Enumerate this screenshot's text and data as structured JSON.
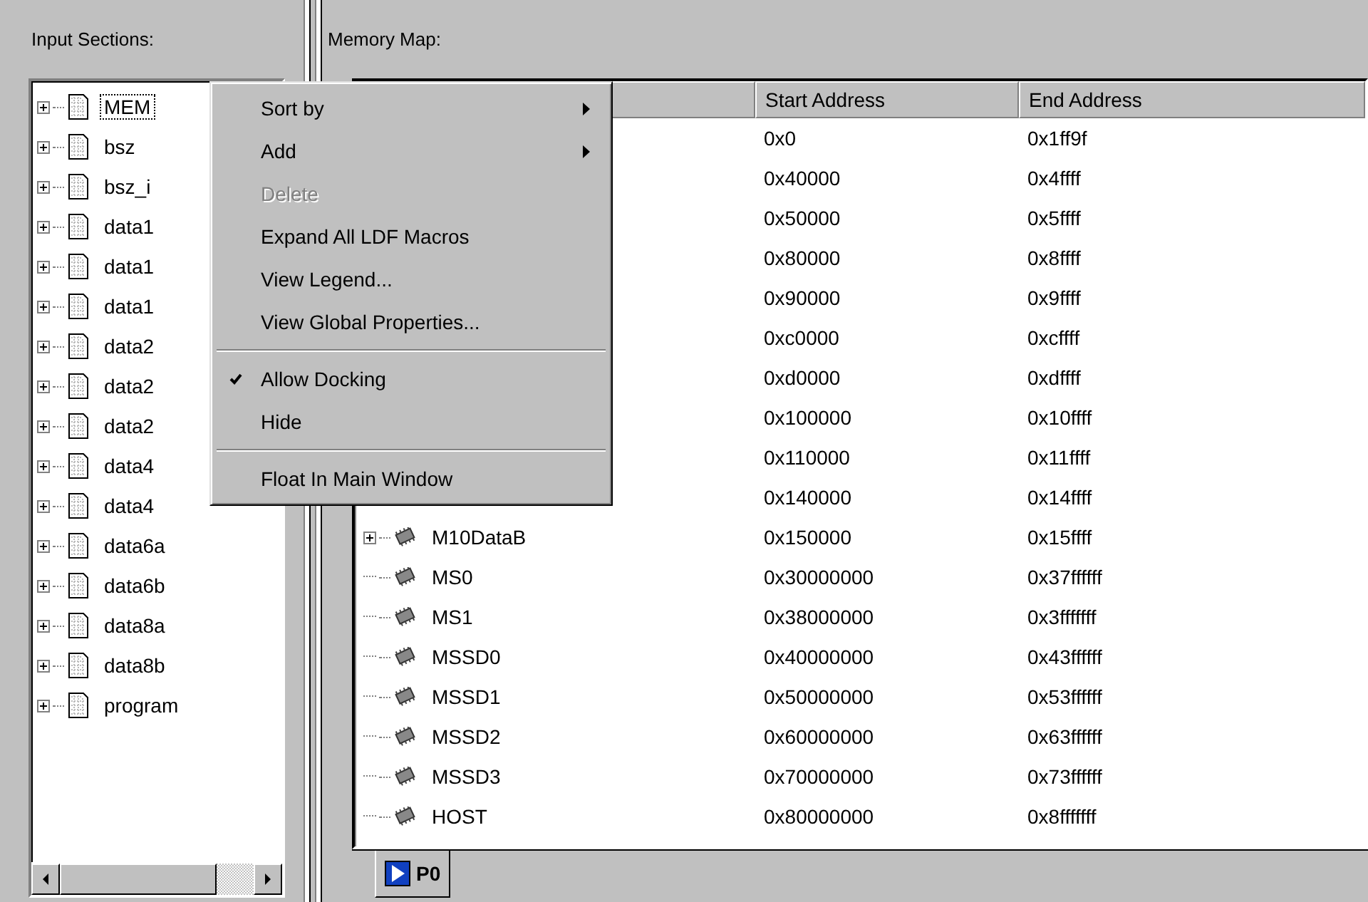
{
  "input_sections": {
    "label": "Input Sections:",
    "items": [
      {
        "name": "MEM",
        "expandable": true,
        "focused": true
      },
      {
        "name": "bsz",
        "expandable": true,
        "focused": false
      },
      {
        "name": "bsz_i",
        "expandable": true,
        "focused": false
      },
      {
        "name": "data1",
        "expandable": true,
        "focused": false
      },
      {
        "name": "data1",
        "expandable": true,
        "focused": false
      },
      {
        "name": "data1",
        "expandable": true,
        "focused": false
      },
      {
        "name": "data2",
        "expandable": true,
        "focused": false
      },
      {
        "name": "data2",
        "expandable": true,
        "focused": false
      },
      {
        "name": "data2",
        "expandable": true,
        "focused": false
      },
      {
        "name": "data4",
        "expandable": true,
        "focused": false
      },
      {
        "name": "data4",
        "expandable": true,
        "focused": false
      },
      {
        "name": "data6a",
        "expandable": true,
        "focused": false
      },
      {
        "name": "data6b",
        "expandable": true,
        "focused": false
      },
      {
        "name": "data8a",
        "expandable": true,
        "focused": false
      },
      {
        "name": "data8b",
        "expandable": true,
        "focused": false
      },
      {
        "name": "program",
        "expandable": true,
        "focused": false
      }
    ]
  },
  "memory_map": {
    "label": "Memory Map:",
    "columns": [
      "Start Address",
      "End Address"
    ],
    "rows": [
      {
        "start": "0x0",
        "end": "0x1ff9f"
      },
      {
        "start": "0x40000",
        "end": "0x4ffff"
      },
      {
        "start": "0x50000",
        "end": "0x5ffff"
      },
      {
        "start": "0x80000",
        "end": "0x8ffff"
      },
      {
        "start": "0x90000",
        "end": "0x9ffff"
      },
      {
        "start": "0xc0000",
        "end": "0xcffff"
      },
      {
        "start": "0xd0000",
        "end": "0xdffff"
      },
      {
        "start": "0x100000",
        "end": "0x10ffff"
      },
      {
        "start": "0x110000",
        "end": "0x11ffff"
      },
      {
        "start": "0x140000",
        "end": "0x14ffff"
      },
      {
        "name": "M10DataB",
        "expandable": true,
        "start": "0x150000",
        "end": "0x15ffff"
      },
      {
        "name": "MS0",
        "expandable": false,
        "start": "0x30000000",
        "end": "0x37ffffff"
      },
      {
        "name": "MS1",
        "expandable": false,
        "start": "0x38000000",
        "end": "0x3fffffff"
      },
      {
        "name": "MSSD0",
        "expandable": false,
        "start": "0x40000000",
        "end": "0x43ffffff"
      },
      {
        "name": "MSSD1",
        "expandable": false,
        "start": "0x50000000",
        "end": "0x53ffffff"
      },
      {
        "name": "MSSD2",
        "expandable": false,
        "start": "0x60000000",
        "end": "0x63ffffff"
      },
      {
        "name": "MSSD3",
        "expandable": false,
        "start": "0x70000000",
        "end": "0x73ffffff"
      },
      {
        "name": "HOST",
        "expandable": false,
        "start": "0x80000000",
        "end": "0x8fffffff"
      }
    ],
    "tabs": [
      {
        "label": "P0",
        "selected": true
      }
    ]
  },
  "context_menu": {
    "items": [
      {
        "kind": "item",
        "label": "Sort by",
        "submenu": true,
        "disabled": false,
        "checked": false
      },
      {
        "kind": "item",
        "label": "Add",
        "submenu": true,
        "disabled": false,
        "checked": false
      },
      {
        "kind": "item",
        "label": "Delete",
        "submenu": false,
        "disabled": true,
        "checked": false
      },
      {
        "kind": "item",
        "label": "Expand All LDF Macros",
        "submenu": false,
        "disabled": false,
        "checked": false
      },
      {
        "kind": "item",
        "label": "View Legend...",
        "submenu": false,
        "disabled": false,
        "checked": false
      },
      {
        "kind": "item",
        "label": "View Global Properties...",
        "submenu": false,
        "disabled": false,
        "checked": false
      },
      {
        "kind": "separator"
      },
      {
        "kind": "item",
        "label": "Allow Docking",
        "submenu": false,
        "disabled": false,
        "checked": true
      },
      {
        "kind": "item",
        "label": "Hide",
        "submenu": false,
        "disabled": false,
        "checked": false
      },
      {
        "kind": "separator"
      },
      {
        "kind": "item",
        "label": "Float In Main Window",
        "submenu": false,
        "disabled": false,
        "checked": false
      }
    ]
  }
}
